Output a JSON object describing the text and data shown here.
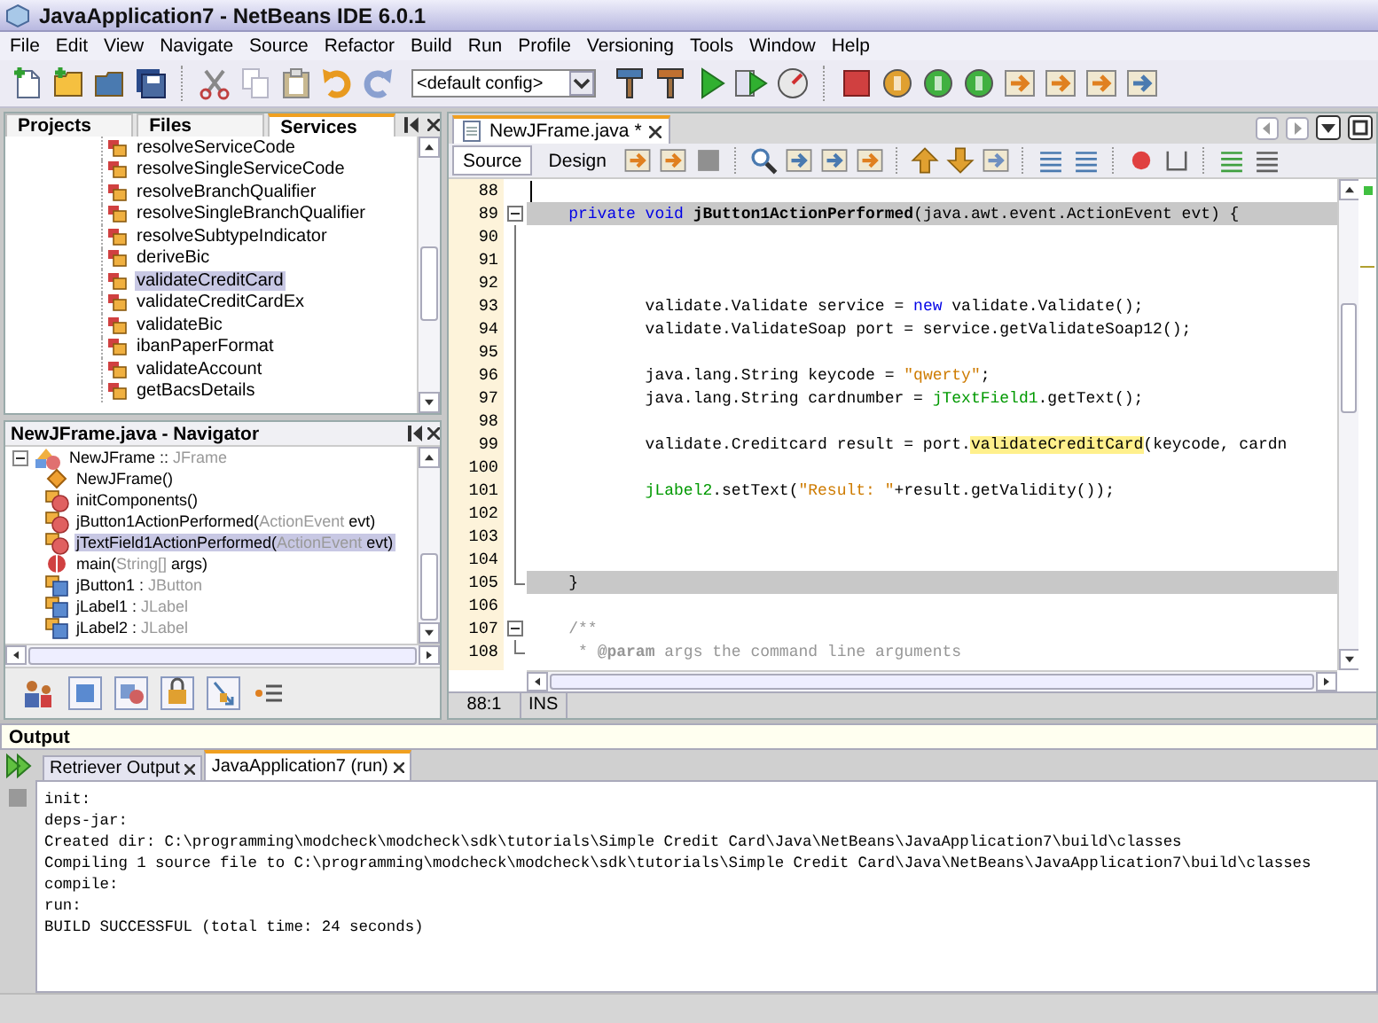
{
  "window": {
    "title": "JavaApplication7 - NetBeans IDE 6.0.1"
  },
  "menu": [
    "File",
    "Edit",
    "View",
    "Navigate",
    "Source",
    "Refactor",
    "Build",
    "Run",
    "Profile",
    "Versioning",
    "Tools",
    "Window",
    "Help"
  ],
  "toolbar": {
    "config": "<default config>"
  },
  "left_tabs": [
    {
      "label": "Projects",
      "selected": false
    },
    {
      "label": "Files",
      "selected": false
    },
    {
      "label": "Services",
      "selected": true
    }
  ],
  "services": [
    {
      "label": "resolveServiceCode",
      "selected": false
    },
    {
      "label": "resolveSingleServiceCode",
      "selected": false
    },
    {
      "label": "resolveBranchQualifier",
      "selected": false
    },
    {
      "label": "resolveSingleBranchQualifier",
      "selected": false
    },
    {
      "label": "resolveSubtypeIndicator",
      "selected": false
    },
    {
      "label": "deriveBic",
      "selected": false
    },
    {
      "label": "validateCreditCard",
      "selected": true
    },
    {
      "label": "validateCreditCardEx",
      "selected": false
    },
    {
      "label": "validateBic",
      "selected": false
    },
    {
      "label": "ibanPaperFormat",
      "selected": false
    },
    {
      "label": "validateAccount",
      "selected": false
    },
    {
      "label": "getBacsDetails",
      "selected": false
    }
  ],
  "navigator": {
    "title": "NewJFrame.java - Navigator",
    "items": [
      {
        "kind": "class",
        "name": "NewJFrame :: ",
        "type": "JFrame",
        "expanded": true,
        "selected": false,
        "children": [
          {
            "kind": "constructor",
            "name": "NewJFrame()",
            "selected": false
          },
          {
            "kind": "method",
            "name": "initComponents()",
            "selected": false
          },
          {
            "kind": "method",
            "name": "jButton1ActionPerformed(",
            "type": "ActionEvent",
            "suffix": " evt)",
            "selected": false
          },
          {
            "kind": "method",
            "name": "jTextField1ActionPerformed(",
            "type": "ActionEvent",
            "suffix": " evt)",
            "selected": true
          },
          {
            "kind": "main",
            "name": "main(",
            "type": "String[]",
            "suffix": " args)",
            "selected": false
          },
          {
            "kind": "field",
            "name": "jButton1 : ",
            "type": "JButton",
            "selected": false
          },
          {
            "kind": "field",
            "name": "jLabel1 : ",
            "type": "JLabel",
            "selected": false
          },
          {
            "kind": "field",
            "name": "jLabel2 : ",
            "type": "JLabel",
            "selected": false
          }
        ]
      }
    ]
  },
  "editor": {
    "tabs": [
      {
        "label": "NewJFrame.java *",
        "selected": true
      }
    ],
    "views": [
      {
        "label": "Source",
        "selected": true
      },
      {
        "label": "Design",
        "selected": false
      }
    ],
    "lines": [
      {
        "number": "88",
        "highlighted": false,
        "fold_start": false,
        "in_fold": false
      },
      {
        "number": "89",
        "highlighted": true,
        "fold_start": true,
        "in_fold": false,
        "tokens": [
          {
            "kind": "keyword",
            "text": "    private void "
          },
          {
            "kind": "method",
            "text": "jButton1ActionPerformed"
          },
          {
            "kind": "plain",
            "text": "(java.awt.event.ActionEvent evt) {"
          }
        ]
      },
      {
        "number": "90",
        "highlighted": false,
        "fold_start": false,
        "in_fold": true
      },
      {
        "number": "91",
        "highlighted": false,
        "fold_start": false,
        "in_fold": true
      },
      {
        "number": "92",
        "highlighted": false,
        "fold_start": false,
        "in_fold": true
      },
      {
        "number": "93",
        "highlighted": false,
        "fold_start": false,
        "in_fold": true,
        "tokens": [
          {
            "kind": "plain",
            "text": "            validate.Validate service = "
          },
          {
            "kind": "keyword",
            "text": "new"
          },
          {
            "kind": "plain",
            "text": " validate.Validate();"
          }
        ]
      },
      {
        "number": "94",
        "highlighted": false,
        "fold_start": false,
        "in_fold": true,
        "tokens": [
          {
            "kind": "plain",
            "text": "            validate.ValidateSoap port = service.getValidateSoap12();"
          }
        ]
      },
      {
        "number": "95",
        "highlighted": false,
        "fold_start": false,
        "in_fold": true
      },
      {
        "number": "96",
        "highlighted": false,
        "fold_start": false,
        "in_fold": true,
        "tokens": [
          {
            "kind": "plain",
            "text": "            java.lang.String keycode = "
          },
          {
            "kind": "string",
            "text": "\"qwerty\""
          },
          {
            "kind": "plain",
            "text": ";"
          }
        ]
      },
      {
        "number": "97",
        "highlighted": false,
        "fold_start": false,
        "in_fold": true,
        "tokens": [
          {
            "kind": "plain",
            "text": "            java.lang.String cardnumber = "
          },
          {
            "kind": "field",
            "text": "jTextField1"
          },
          {
            "kind": "plain",
            "text": ".getText();"
          }
        ]
      },
      {
        "number": "98",
        "highlighted": false,
        "fold_start": false,
        "in_fold": true
      },
      {
        "number": "99",
        "highlighted": false,
        "fold_start": false,
        "in_fold": true,
        "tokens": [
          {
            "kind": "plain",
            "text": "            validate.Creditcard result = port."
          },
          {
            "kind": "match",
            "text": "validateCreditCard"
          },
          {
            "kind": "plain",
            "text": "(keycode, cardn"
          }
        ]
      },
      {
        "number": "100",
        "highlighted": false,
        "fold_start": false,
        "in_fold": true
      },
      {
        "number": "101",
        "highlighted": false,
        "fold_start": false,
        "in_fold": true,
        "tokens": [
          {
            "kind": "field",
            "text": "            jLabel2"
          },
          {
            "kind": "plain",
            "text": ".setText("
          },
          {
            "kind": "string",
            "text": "\"Result: \""
          },
          {
            "kind": "plain",
            "text": "+result.getValidity());"
          }
        ]
      },
      {
        "number": "102",
        "highlighted": false,
        "fold_start": false,
        "in_fold": true
      },
      {
        "number": "103",
        "highlighted": false,
        "fold_start": false,
        "in_fold": true
      },
      {
        "number": "104",
        "highlighted": false,
        "fold_start": false,
        "in_fold": true
      },
      {
        "number": "105",
        "highlighted": true,
        "fold_start": false,
        "in_fold": true,
        "tokens": [
          {
            "kind": "plain",
            "text": "    }"
          }
        ]
      },
      {
        "number": "106",
        "highlighted": false,
        "fold_start": false,
        "in_fold": false
      },
      {
        "number": "107",
        "highlighted": false,
        "fold_start": true,
        "in_fold": false,
        "tokens": [
          {
            "kind": "comment",
            "text": "    /**"
          }
        ]
      },
      {
        "number": "108",
        "highlighted": false,
        "fold_start": false,
        "in_fold": true,
        "tokens": [
          {
            "kind": "comment",
            "text": "     * "
          },
          {
            "kind": "tag",
            "text": "@param"
          },
          {
            "kind": "comment",
            "text": " args the command line arguments"
          }
        ]
      }
    ],
    "position": "88:1",
    "mode": "INS"
  },
  "output": {
    "title": "Output",
    "tabs": [
      {
        "label": "Retriever Output",
        "selected": false
      },
      {
        "label": "JavaApplication7 (run)",
        "selected": true
      }
    ],
    "lines": [
      "init:",
      "deps-jar:",
      "Created dir: C:\\programming\\modcheck\\modcheck\\sdk\\tutorials\\Simple Credit Card\\Java\\NetBeans\\JavaApplication7\\build\\classes",
      "Compiling 1 source file to C:\\programming\\modcheck\\modcheck\\sdk\\tutorials\\Simple Credit Card\\Java\\NetBeans\\JavaApplication7\\build\\classes",
      "compile:",
      "run:",
      "BUILD SUCCESSFUL (total time: 24 seconds)"
    ]
  }
}
